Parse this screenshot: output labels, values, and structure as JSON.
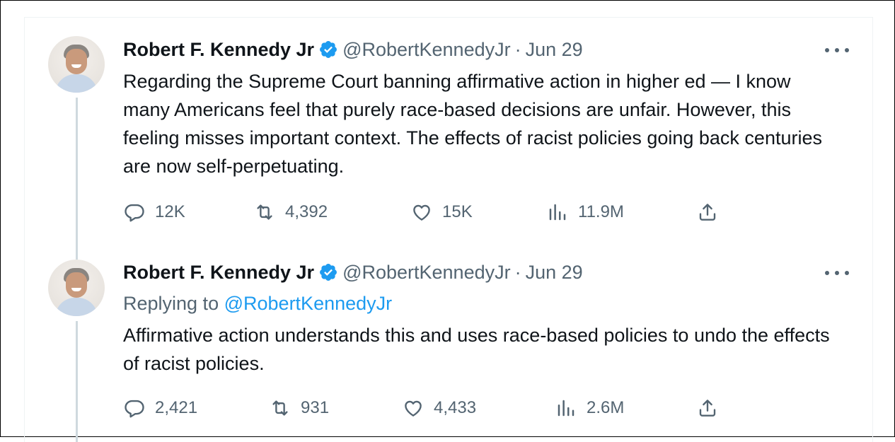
{
  "colors": {
    "text": "#0f1419",
    "secondary": "#536471",
    "link": "#1d9bf0",
    "verified": "#1d9bf0",
    "thread_line": "#cfd9de"
  },
  "tweets": [
    {
      "author_name": "Robert F. Kennedy Jr",
      "handle": "@RobertKennedyJr",
      "separator": "·",
      "date": "Jun 29",
      "text": "Regarding the Supreme Court banning affirmative action in higher ed — I know many Americans feel that purely race-based decisions are unfair. However, this feeling misses important context. The effects of racist policies going back centuries are now self-perpetuating.",
      "replies": "12K",
      "retweets": "4,392",
      "likes": "15K",
      "views": "11.9M"
    },
    {
      "author_name": "Robert F. Kennedy Jr",
      "handle": "@RobertKennedyJr",
      "separator": "·",
      "date": "Jun 29",
      "replying_to_label": "Replying to",
      "replying_to_handle": "@RobertKennedyJr",
      "text": "Affirmative action understands this and uses race-based policies to undo the effects of racist policies.",
      "replies": "2,421",
      "retweets": "931",
      "likes": "4,433",
      "views": "2.6M"
    }
  ],
  "icons": {
    "verified": "verified-badge-icon",
    "more": "more-options-icon",
    "reply": "reply-bubble-icon",
    "retweet": "retweet-icon",
    "like": "heart-icon",
    "views": "views-bar-chart-icon",
    "share": "share-upload-icon"
  }
}
